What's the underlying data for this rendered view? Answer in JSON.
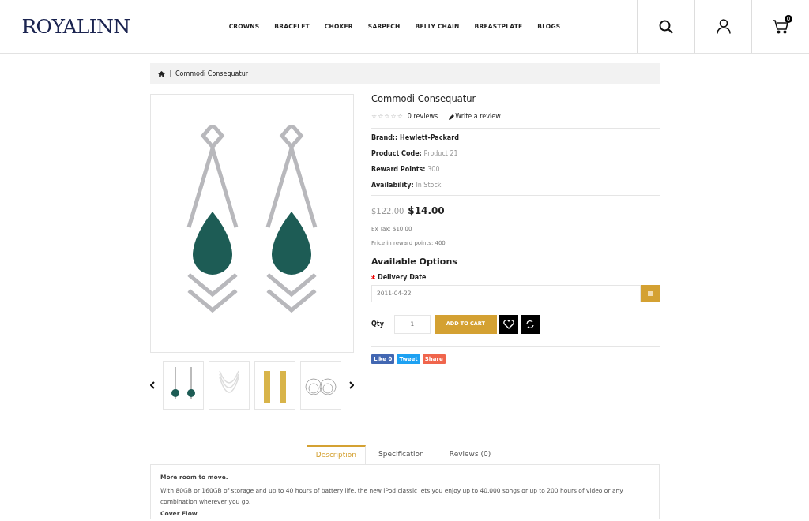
{
  "logo": {
    "text": "ROYALINN"
  },
  "nav": [
    "CROWNS",
    "BRACELET",
    "CHOKER",
    "SARPECH",
    "BELLY CHAIN",
    "BREASTPLATE",
    "BLOGS"
  ],
  "cart_count": "0",
  "breadcrumb": [
    "Commodi Consequatur"
  ],
  "product": {
    "title": "Commodi Consequatur",
    "stars": 0,
    "reviews": "0 reviews",
    "write_review": "Write a review",
    "details": [
      {
        "label": "Brand::",
        "value": "Hewlett-Packard",
        "kind": "link"
      },
      {
        "label": "Product Code:",
        "value": "Product 21",
        "kind": "plain"
      },
      {
        "label": "Reward Points:",
        "value": "300",
        "kind": "plain"
      },
      {
        "label": "Availability:",
        "value": "In Stock",
        "kind": "plain"
      }
    ],
    "old_price": "$122.00",
    "price": "$14.00",
    "ex_tax": "Ex Tax: $10.00",
    "reward_price": "Price in reward points: 400"
  },
  "options": {
    "heading": "Available Options",
    "field_label": "Delivery Date",
    "required": true,
    "date_value": "2011-04-22"
  },
  "qty_label": "Qty",
  "qty_value": "1",
  "add_to_cart": "ADD TO CART",
  "share": [
    {
      "label": "Like 0",
      "kind": "like"
    },
    {
      "label": "Tweet",
      "kind": "tweet"
    },
    {
      "label": "Share",
      "kind": "share"
    }
  ],
  "thumbnails": [
    {
      "kind": "earring-green",
      "selected": false
    },
    {
      "kind": "necklace",
      "selected": false
    },
    {
      "kind": "earring-gold",
      "selected": false
    },
    {
      "kind": "earring-hoop",
      "selected": false
    }
  ],
  "tabs": [
    {
      "label": "Description",
      "selected": true
    },
    {
      "label": "Specification",
      "selected": false
    },
    {
      "label": "Reviews (0)",
      "selected": false
    }
  ],
  "description": {
    "heading": "More room to move.",
    "body": "With 80GB or 160GB of storage and up to 40 hours of battery life, the new iPod classic lets you enjoy up to 40,000 songs or up to 200 hours of video or any combination wherever you go.",
    "subheading": "Cover Flow"
  }
}
